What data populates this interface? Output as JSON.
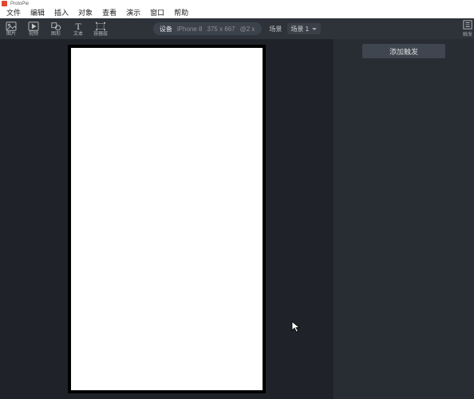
{
  "titlebar": {
    "text": "ProtoPie"
  },
  "menu": {
    "items": [
      "文件",
      "编辑",
      "插入",
      "对象",
      "查看",
      "演示",
      "窗口",
      "帮助"
    ]
  },
  "toolbar": {
    "left": [
      {
        "name": "image-tool",
        "label": "图片"
      },
      {
        "name": "video-tool",
        "label": "视频"
      },
      {
        "name": "shape-tool",
        "label": "图形"
      },
      {
        "name": "text-tool",
        "label": "文本"
      },
      {
        "name": "container-tool",
        "label": "容器层"
      }
    ],
    "device": {
      "label": "设备",
      "model": "iPhone 8",
      "size": "375 x 667",
      "scale": "@2 x"
    },
    "scene": {
      "label": "场景",
      "selected": "场景 1"
    }
  },
  "rightPanel": {
    "addTrigger": "添加触发",
    "tabLabel": "触发"
  }
}
